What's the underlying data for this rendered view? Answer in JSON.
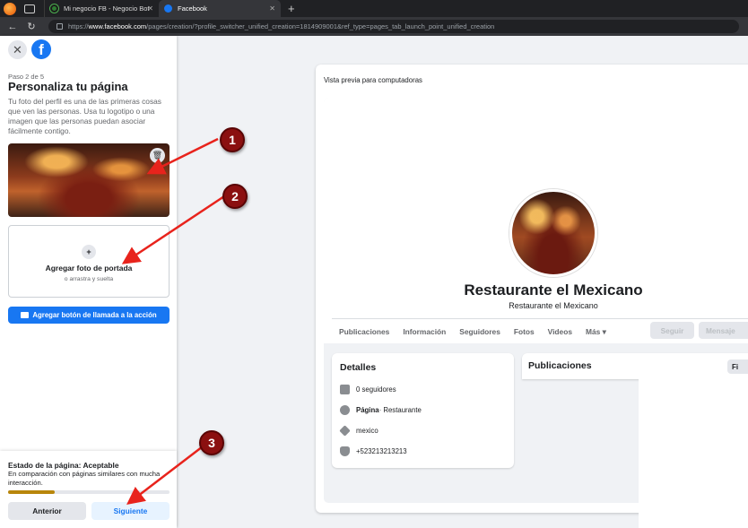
{
  "browser": {
    "tabs": [
      {
        "title": "Mi negocio FB - Negocio Bot"
      },
      {
        "title": "Facebook"
      }
    ],
    "url_domain": "www.facebook.com",
    "url_path": "/pages/creation/?profile_switcher_unified_creation=1814909001&ref_type=pages_tab_launch_point_unified_creation",
    "url_scheme": "https://"
  },
  "panel": {
    "step": "Paso 2 de 5",
    "title": "Personaliza tu página",
    "description": "Tu foto del perfil es una de las primeras cosas que ven las personas. Usa tu logotipo o una imagen que las personas puedan asociar fácilmente contigo.",
    "cover_label": "Agregar foto de portada",
    "cover_sub": "o arrastra y suelta",
    "cta_label": "Agregar botón de llamada a la acción",
    "status_title": "Estado de la página: Aceptable",
    "status_desc": "En comparación con páginas similares con mucha interacción.",
    "progress_fraction": 0.29,
    "prev_label": "Anterior",
    "next_label": "Siguiente"
  },
  "preview": {
    "title": "Vista previa para computadoras",
    "page_name": "Restaurante el Mexicano",
    "category": "Restaurante el Mexicano",
    "tabs": [
      "Publicaciones",
      "Información",
      "Seguidores",
      "Fotos",
      "Videos",
      "Más ▾"
    ],
    "follow_label": "Seguir",
    "message_label": "Mensaje",
    "details": {
      "title": "Detalles",
      "followers": "0 seguidores",
      "page_label": "Página",
      "page_category": " · Restaurante",
      "location": "mexico",
      "phone": "+523213213213"
    },
    "posts_title": "Publicaciones",
    "filter_label": "Fi"
  },
  "annotations": {
    "badges": [
      "1",
      "2",
      "3"
    ],
    "color": "#8b1010",
    "arrow_color": "#e8231c"
  }
}
